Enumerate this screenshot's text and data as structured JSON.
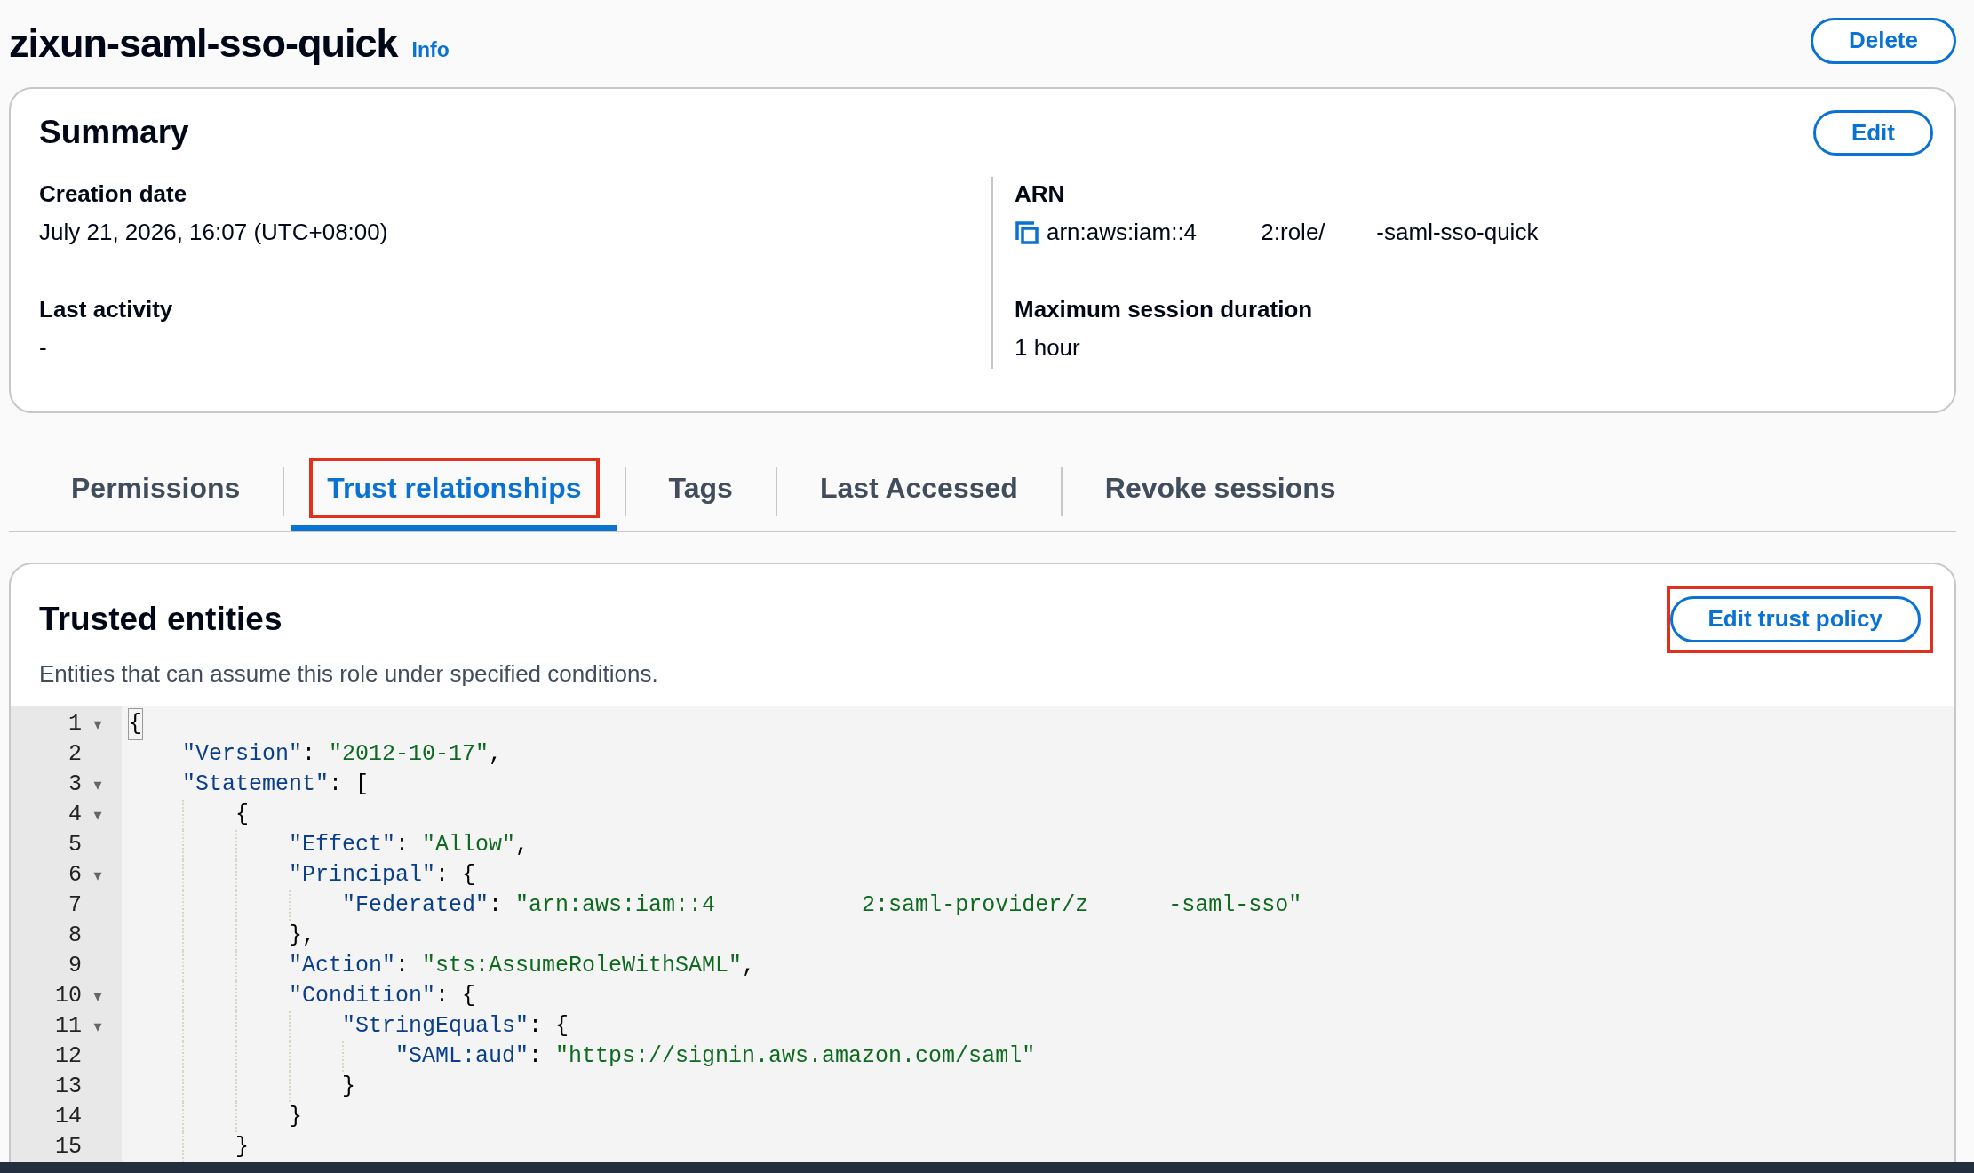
{
  "header": {
    "title": "zixun-saml-sso-quick",
    "info_link": "Info",
    "delete_button": "Delete"
  },
  "summary": {
    "title": "Summary",
    "edit_button": "Edit",
    "left": [
      {
        "label": "Creation date",
        "value": "July 21, 2026, 16:07 (UTC+08:00)"
      },
      {
        "label": "Last activity",
        "value": "-"
      }
    ],
    "right": [
      {
        "label": "ARN",
        "value": "arn:aws:iam::4          2:role/        -saml-sso-quick",
        "kind": "copyable"
      },
      {
        "label": "Maximum session duration",
        "value": "1 hour",
        "kind": "plain"
      }
    ]
  },
  "tabs": [
    {
      "label": "Permissions",
      "selected": false,
      "highlighted": false
    },
    {
      "label": "Trust relationships",
      "selected": true,
      "highlighted": true
    },
    {
      "label": "Tags",
      "selected": false,
      "highlighted": false
    },
    {
      "label": "Last Accessed",
      "selected": false,
      "highlighted": false
    },
    {
      "label": "Revoke sessions",
      "selected": false,
      "highlighted": false
    }
  ],
  "trusted_entities": {
    "title": "Trusted entities",
    "description": "Entities that can assume this role under specified conditions.",
    "edit_button": {
      "label": "Edit trust policy",
      "highlighted": true
    },
    "code_lines": [
      {
        "number": "1",
        "text": "{",
        "fold": "▾"
      },
      {
        "number": "2",
        "text": "    \"Version\": \"2012-10-17\","
      },
      {
        "number": "3",
        "text": "    \"Statement\": [",
        "fold": "▾"
      },
      {
        "number": "4",
        "text": "        {",
        "fold": "▾"
      },
      {
        "number": "5",
        "text": "            \"Effect\": \"Allow\","
      },
      {
        "number": "6",
        "text": "            \"Principal\": {",
        "fold": "▾"
      },
      {
        "number": "7",
        "text": "                \"Federated\": \"arn:aws:iam::4           2:saml-provider/z      -saml-sso\""
      },
      {
        "number": "8",
        "text": "            },"
      },
      {
        "number": "9",
        "text": "            \"Action\": \"sts:AssumeRoleWithSAML\","
      },
      {
        "number": "10",
        "text": "            \"Condition\": {",
        "fold": "▾"
      },
      {
        "number": "11",
        "text": "                \"StringEquals\": {",
        "fold": "▾"
      },
      {
        "number": "12",
        "text": "                    \"SAML:aud\": \"https://signin.aws.amazon.com/saml\""
      },
      {
        "number": "13",
        "text": "                }"
      },
      {
        "number": "14",
        "text": "            }"
      },
      {
        "number": "15",
        "text": "        }"
      }
    ]
  }
}
